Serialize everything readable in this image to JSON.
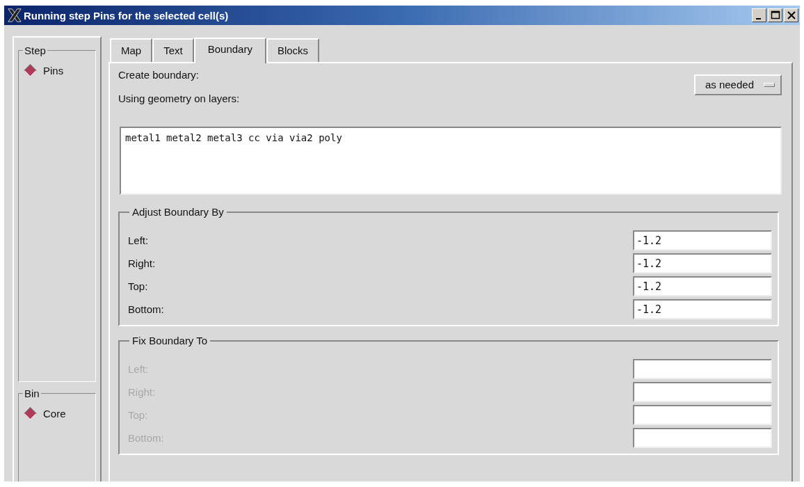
{
  "window": {
    "title": "Running step Pins for the selected cell(s)"
  },
  "step": {
    "title": "Step",
    "options": [
      {
        "label": "Pins",
        "selected": true
      }
    ]
  },
  "bin": {
    "title": "Bin",
    "options": [
      {
        "label": "Core",
        "selected": true
      }
    ]
  },
  "tabs": [
    {
      "label": "Map",
      "selected": false
    },
    {
      "label": "Text",
      "selected": false
    },
    {
      "label": "Boundary",
      "selected": true
    },
    {
      "label": "Blocks",
      "selected": false
    }
  ],
  "create_boundary": {
    "label": "Create boundary:",
    "value": "as needed"
  },
  "layers": {
    "label": "Using geometry on layers:",
    "value": "metal1 metal2 metal3 cc via via2 poly"
  },
  "adjust": {
    "title": "Adjust Boundary By",
    "fields": [
      {
        "label": "Left:",
        "value": "-1.2",
        "disabled": false
      },
      {
        "label": "Right:",
        "value": "-1.2",
        "disabled": false
      },
      {
        "label": "Top:",
        "value": "-1.2",
        "disabled": false
      },
      {
        "label": "Bottom:",
        "value": "-1.2",
        "disabled": false
      }
    ]
  },
  "fix": {
    "title": "Fix Boundary To",
    "fields": [
      {
        "label": "Left:",
        "disabled": true
      },
      {
        "label": "Right:",
        "disabled": true
      },
      {
        "label": "Top:",
        "disabled": true
      },
      {
        "label": "Bottom:",
        "disabled": true
      }
    ]
  }
}
